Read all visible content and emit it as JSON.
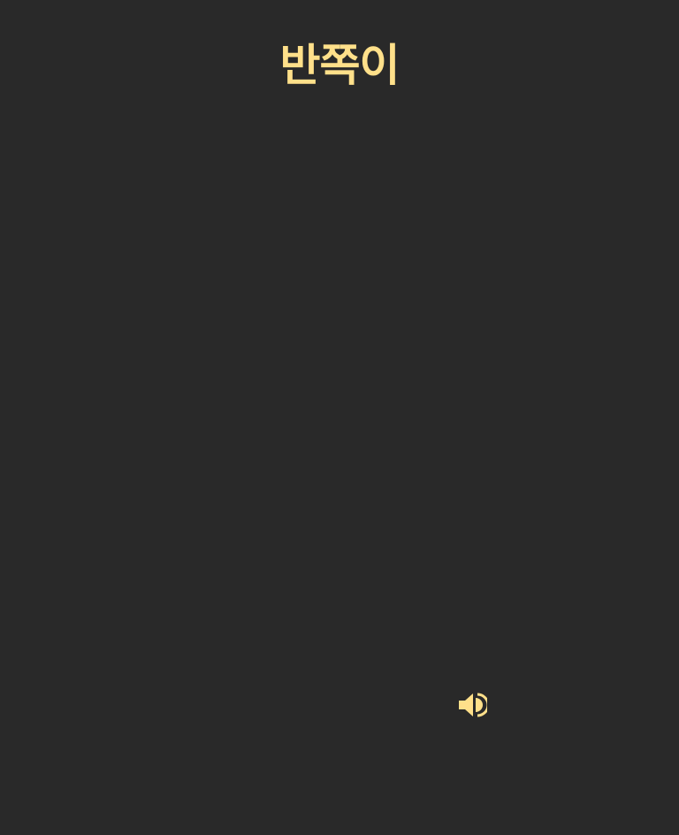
{
  "header": {
    "title": "반쪽이"
  },
  "controls": {
    "sound_icon": "speaker-volume-icon"
  },
  "colors": {
    "background": "#292929",
    "accent": "#FFE08A"
  }
}
